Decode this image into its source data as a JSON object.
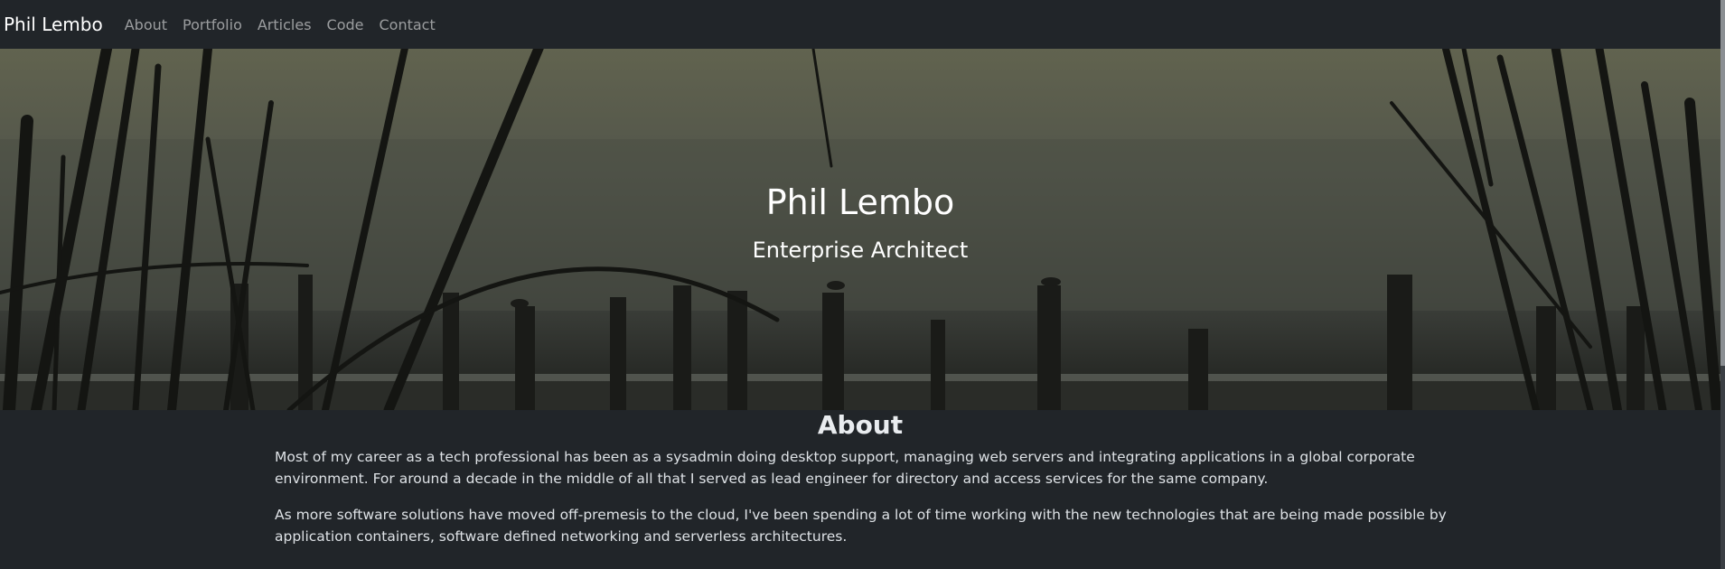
{
  "navbar": {
    "brand": "Phil Lembo",
    "links": [
      "About",
      "Portfolio",
      "Articles",
      "Code",
      "Contact"
    ]
  },
  "hero": {
    "title": "Phil Lembo",
    "subtitle": "Enterprise Architect"
  },
  "about": {
    "title": "About",
    "paragraphs": [
      "Most of my career as a tech professional has been as a sysadmin doing desktop support, managing web servers and integrating applications in a global corporate environment. For around a decade in the middle of all that I served as lead engineer for directory and access services for the same company.",
      "As more software solutions have moved off-premesis to the cloud, I've been spending a lot of time working with the new technologies that are being made possible by application containers, software defined networking and serverless architectures."
    ]
  },
  "colors": {
    "navbar_bg": "#212529",
    "page_bg": "#212529",
    "link": "#8c8f92"
  }
}
